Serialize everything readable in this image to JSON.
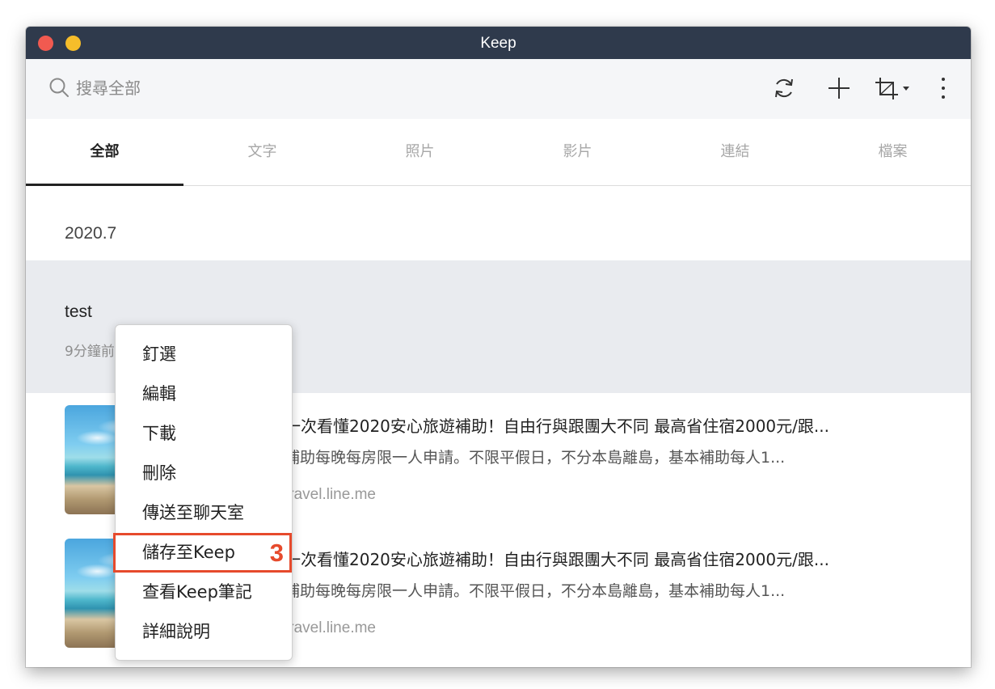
{
  "window": {
    "title": "Keep"
  },
  "toolbar": {
    "search_placeholder": "搜尋全部",
    "icons": [
      "refresh-icon",
      "plus-icon",
      "crop-icon",
      "chevron-down-icon",
      "more-vertical-icon"
    ]
  },
  "tabs": [
    {
      "label": "全部",
      "active": true
    },
    {
      "label": "文字",
      "active": false
    },
    {
      "label": "照片",
      "active": false
    },
    {
      "label": "影片",
      "active": false
    },
    {
      "label": "連結",
      "active": false
    },
    {
      "label": "檔案",
      "active": false
    }
  ],
  "list": {
    "date_header": "2020.7",
    "note": {
      "title": "test",
      "time": "9分鐘前"
    },
    "links": [
      {
        "title": "一次看懂2020安心旅遊補助！自由行與跟團大不同 最高省住宿2000元/跟...",
        "desc": "補助每晚每房限一人申請。不限平假日，不分本島離島，基本補助每人1...",
        "url": "travel.line.me"
      },
      {
        "title": "一次看懂2020安心旅遊補助！自由行與跟團大不同 最高省住宿2000元/跟...",
        "desc": "補助每晚每房限一人申請。不限平假日，不分本島離島，基本補助每人1...",
        "url": "travel.line.me"
      }
    ]
  },
  "context_menu": {
    "items": [
      {
        "label": "釘選"
      },
      {
        "label": "編輯"
      },
      {
        "label": "下載"
      },
      {
        "label": "刪除"
      },
      {
        "label": "傳送至聊天室"
      },
      {
        "label": "儲存至Keep",
        "highlighted": true
      },
      {
        "label": "查看Keep筆記"
      },
      {
        "label": "詳細說明"
      }
    ],
    "step_badge": "3",
    "highlight_color": "#e64a2c"
  },
  "colors": {
    "titlebar": "#2f3a4c",
    "toolbar": "#f5f6f8",
    "note_selected": "#e9ebef",
    "close_button": "#f15a50",
    "minimize_button": "#f6bd2a"
  }
}
